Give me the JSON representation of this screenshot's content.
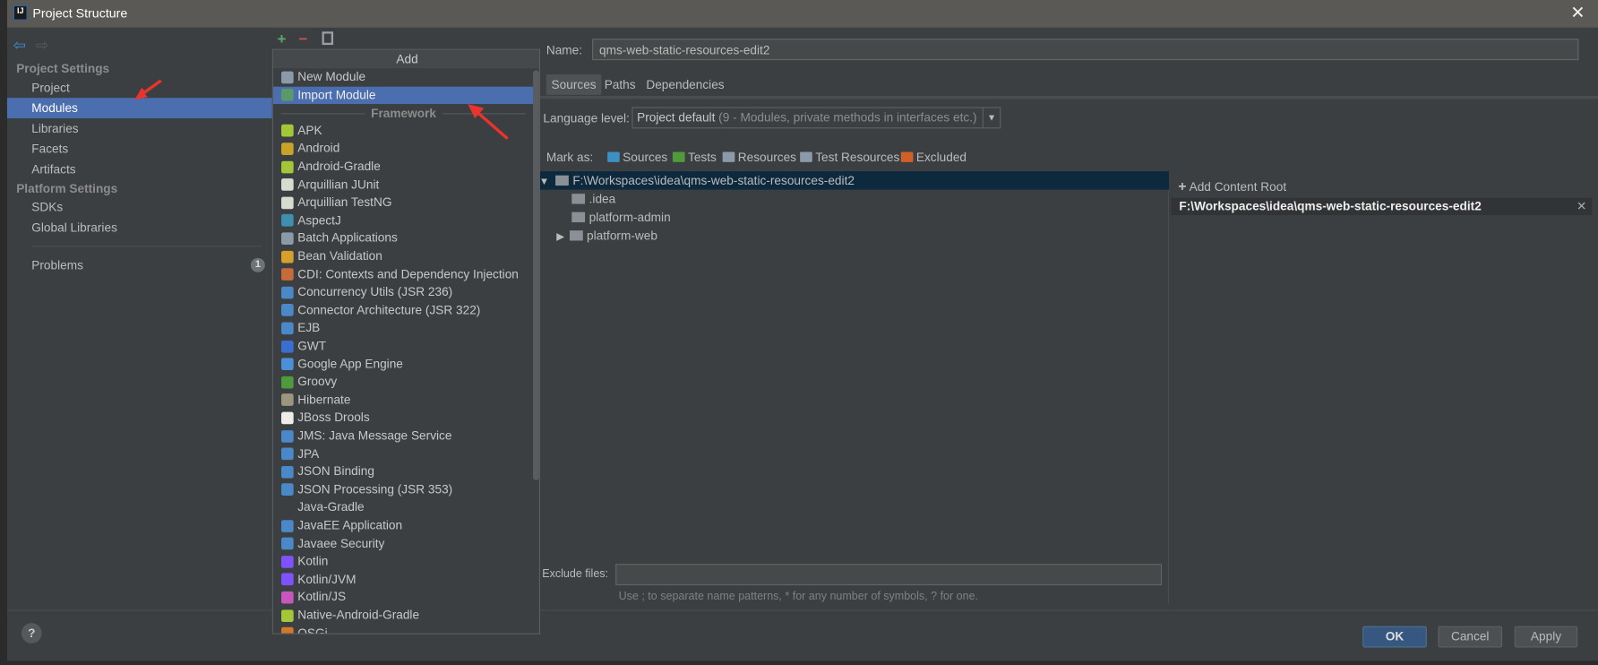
{
  "window": {
    "title": "Project Structure",
    "logo_text": "IJ"
  },
  "sidebar": {
    "sections": [
      {
        "label": "Project Settings"
      },
      {
        "label": "Platform Settings"
      }
    ],
    "items": [
      {
        "label": "Project"
      },
      {
        "label": "Modules",
        "selected": true
      },
      {
        "label": "Libraries"
      },
      {
        "label": "Facets"
      },
      {
        "label": "Artifacts"
      },
      {
        "label": "SDKs"
      },
      {
        "label": "Global Libraries"
      },
      {
        "label": "Problems",
        "badge": "1"
      }
    ]
  },
  "popup": {
    "title": "Add",
    "top_items": [
      {
        "label": "New Module",
        "icon": "module-icon"
      },
      {
        "label": "Import Module",
        "icon": "import-icon",
        "selected": true
      }
    ],
    "separator": "Framework",
    "frameworks": [
      {
        "label": "APK",
        "color": "#a4c639"
      },
      {
        "label": "Android",
        "color": "#c9a227"
      },
      {
        "label": "Android-Gradle",
        "color": "#a4c639"
      },
      {
        "label": "Arquillian JUnit",
        "color": "#d8dcd0"
      },
      {
        "label": "Arquillian TestNG",
        "color": "#d8dcd0"
      },
      {
        "label": "AspectJ",
        "color": "#3f8fb0"
      },
      {
        "label": "Batch Applications",
        "color": "#8a9aa8"
      },
      {
        "label": "Bean Validation",
        "color": "#d6a02a"
      },
      {
        "label": "CDI: Contexts and Dependency Injection",
        "color": "#c86b3c"
      },
      {
        "label": "Concurrency Utils (JSR 236)",
        "color": "#4a88c7"
      },
      {
        "label": "Connector Architecture (JSR 322)",
        "color": "#4a88c7"
      },
      {
        "label": "EJB",
        "color": "#4a88c7"
      },
      {
        "label": "GWT",
        "color": "#3a6fd0"
      },
      {
        "label": "Google App Engine",
        "color": "#4a8fd8"
      },
      {
        "label": "Groovy",
        "color": "#4f9a3a"
      },
      {
        "label": "Hibernate",
        "color": "#9c9680"
      },
      {
        "label": "JBoss Drools",
        "color": "#f0ece8"
      },
      {
        "label": "JMS: Java Message Service",
        "color": "#4a88c7"
      },
      {
        "label": "JPA",
        "color": "#4a88c7"
      },
      {
        "label": "JSON Binding",
        "color": "#4a88c7"
      },
      {
        "label": "JSON Processing (JSR 353)",
        "color": "#4a88c7"
      },
      {
        "label": "Java-Gradle",
        "color": ""
      },
      {
        "label": "JavaEE Application",
        "color": "#4a88c7"
      },
      {
        "label": "Javaee Security",
        "color": "#4a88c7"
      },
      {
        "label": "Kotlin",
        "color": "#7f52ff"
      },
      {
        "label": "Kotlin/JVM",
        "color": "#7f52ff"
      },
      {
        "label": "Kotlin/JS",
        "color": "#c757bc"
      },
      {
        "label": "Native-Android-Gradle",
        "color": "#a4c639"
      },
      {
        "label": "OSGi",
        "color": "#d2782a"
      }
    ]
  },
  "module": {
    "name_label": "Name:",
    "name_value": "qms-web-static-resources-edit2",
    "tabs": [
      {
        "label": "Sources",
        "selected": true
      },
      {
        "label": "Paths"
      },
      {
        "label": "Dependencies"
      }
    ],
    "language_label": "Language level:",
    "language_value": "Project default",
    "language_detail": " (9 - Modules, private methods in interfaces etc.)",
    "mark_as_label": "Mark as:",
    "mark_as": [
      {
        "label": "Sources",
        "color": "#3d8fc4"
      },
      {
        "label": "Tests",
        "color": "#4f9a3a"
      },
      {
        "label": "Resources",
        "color": "#8a9aa8"
      },
      {
        "label": "Test Resources",
        "color": "#8a9aa8"
      },
      {
        "label": "Excluded",
        "color": "#d0602a"
      }
    ],
    "tree": [
      {
        "label": "F:\\Workspaces\\idea\\qms-web-static-resources-edit2",
        "expanded": true,
        "selected": true
      },
      {
        "label": ".idea"
      },
      {
        "label": "platform-admin"
      },
      {
        "label": "platform-web",
        "collapsed": true
      }
    ],
    "add_content_root": "Add Content Root",
    "content_root": "F:\\Workspaces\\idea\\qms-web-static-resources-edit2",
    "exclude_label": "Exclude files:",
    "exclude_value": "",
    "exclude_hint": "Use ; to separate name patterns, * for any number of symbols, ? for one."
  },
  "buttons": {
    "ok": "OK",
    "cancel": "Cancel",
    "apply": "Apply",
    "help": "?"
  },
  "colors": {
    "selection": "#4b6eaf",
    "tree_selection": "#0d293e",
    "ok_button": "#365880",
    "annotation_arrow": "#e8342c"
  }
}
